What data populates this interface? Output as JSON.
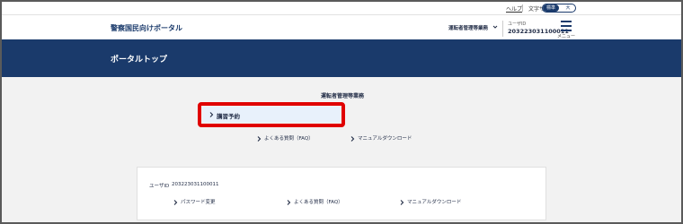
{
  "util": {
    "help": "ヘルプ",
    "font_size_label": "文字サイズ",
    "font_size_options": [
      "標準",
      "大"
    ]
  },
  "header": {
    "site_title": "警察国民向けポータル",
    "service_select": "運転者管理等業務",
    "user_id_label": "ユーザID",
    "user_id_value": "203223031100011",
    "menu_label": "メニュー"
  },
  "banner": {
    "title": "ポータルトップ"
  },
  "main": {
    "section_heading": "運転者管理等業務",
    "course_button": "講習予約",
    "links": [
      "よくある質問（FAQ）",
      "マニュアルダウンロード"
    ]
  },
  "user_card": {
    "user_id_label": "ユーザID",
    "user_id_value": "203223031100011",
    "links": [
      "パスワード変更",
      "よくある質問（FAQ）",
      "マニュアルダウンロード"
    ]
  },
  "colors": {
    "navy": "#1a3a6b",
    "highlight": "#e00000",
    "button_bg": "#e8f1fb"
  }
}
